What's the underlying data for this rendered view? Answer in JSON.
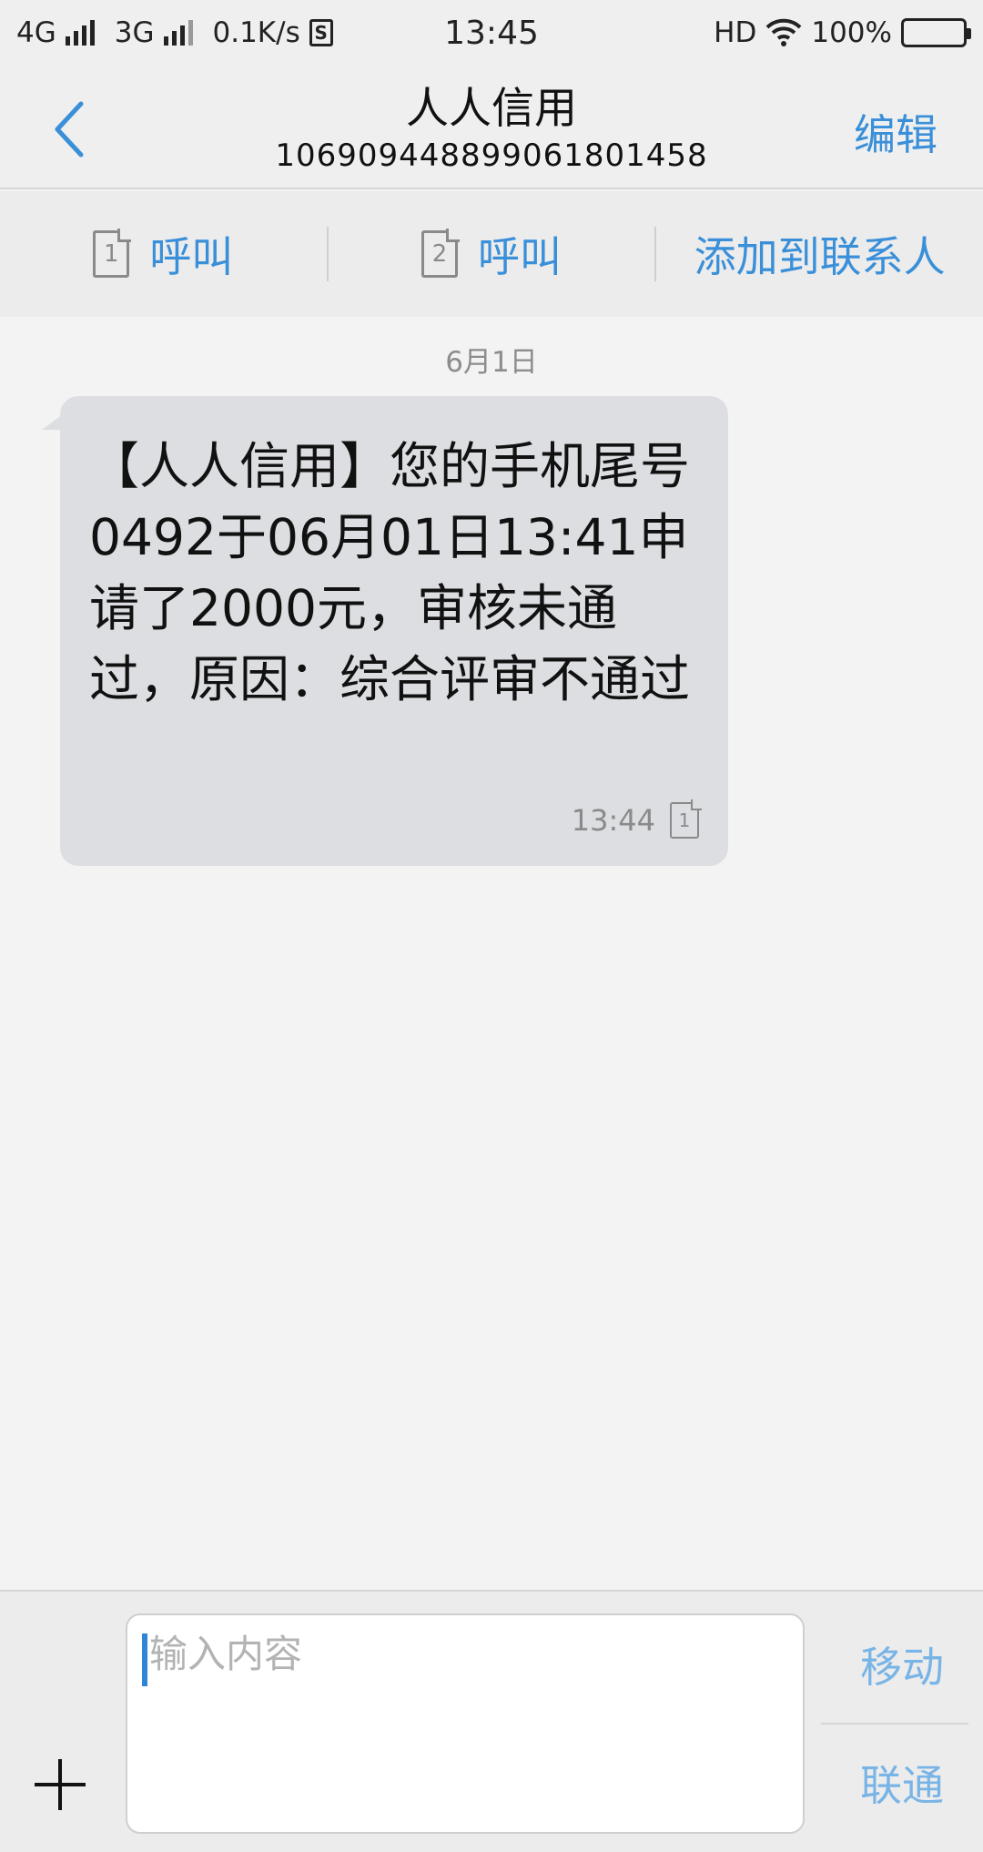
{
  "status_bar": {
    "net1": "4G",
    "net2": "3G",
    "speed": "0.1K/s",
    "s_badge": "S",
    "time": "13:45",
    "hd": "HD",
    "battery": "100%"
  },
  "header": {
    "back_icon": "chevron-left-icon",
    "title": "人人信用",
    "number": "106909448899061801458",
    "edit_label": "编辑"
  },
  "actions": [
    {
      "sim": "1",
      "label": "呼叫"
    },
    {
      "sim": "2",
      "label": "呼叫"
    },
    {
      "label": "添加到联系人"
    }
  ],
  "conversation": {
    "date": "6月1日",
    "message": {
      "text": "【人人信用】您的手机尾号0492于06月01日13:41申请了2000元，审核未通过，原因：综合评审不通过",
      "time": "13:44",
      "sim": "1"
    }
  },
  "composer": {
    "placeholder": "输入内容",
    "send_sim1": "移动",
    "send_sim2": "联通"
  },
  "colors": {
    "accent": "#3a8fd9",
    "bubble": "#dcdee1",
    "background": "#f3f3f3"
  }
}
